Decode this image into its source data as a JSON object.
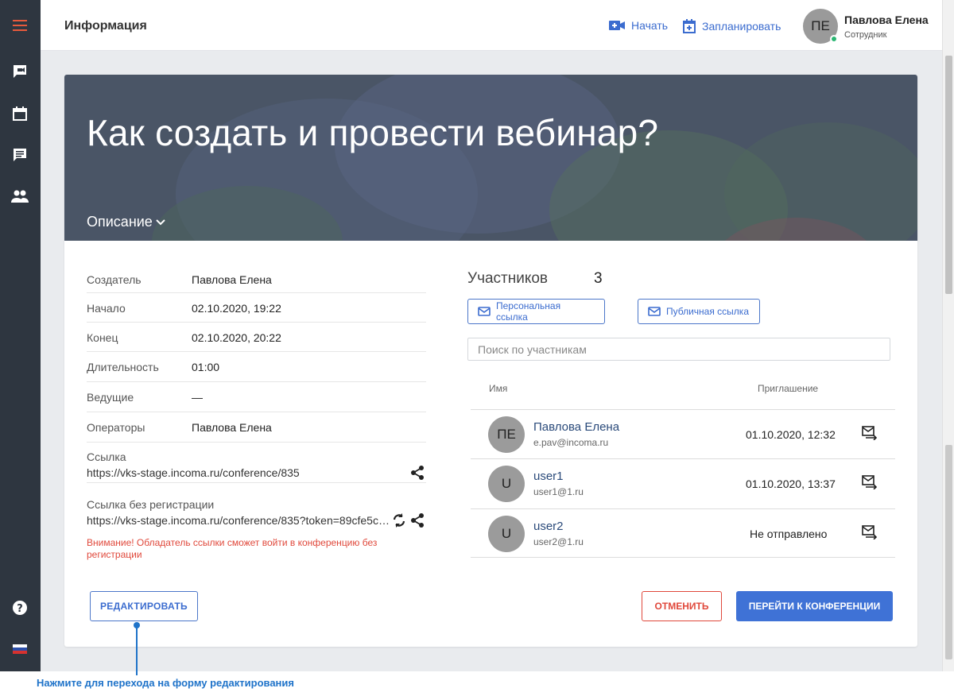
{
  "header": {
    "page_title": "Информация",
    "start_label": "Начать",
    "schedule_label": "Запланировать",
    "user": {
      "initials": "ПЕ",
      "name": "Павлова Елена",
      "role": "Сотрудник"
    }
  },
  "banner": {
    "title": "Как создать и провести вебинар?",
    "description_label": "Описание"
  },
  "details": {
    "rows": [
      {
        "label": "Создатель",
        "value": "Павлова Елена"
      },
      {
        "label": "Начало",
        "value": "02.10.2020, 19:22"
      },
      {
        "label": "Конец",
        "value": "02.10.2020, 20:22"
      },
      {
        "label": "Длительность",
        "value": "01:00"
      },
      {
        "label": "Ведущие",
        "value": "—"
      },
      {
        "label": "Операторы",
        "value": "Павлова Елена"
      }
    ],
    "link_label": "Ссылка",
    "link_value": "https://vks-stage.incoma.ru/conference/835",
    "noreg_label": "Ссылка без регистрации",
    "noreg_value": "https://vks-stage.incoma.ru/conference/835?token=89cfe5ca...",
    "warning": "Внимание! Обладатель ссылки сможет войти в конференцию без регистрации"
  },
  "participants": {
    "title": "Участников",
    "count": "3",
    "personal_link_label": "Персональная ссылка",
    "public_link_label": "Публичная ссылка",
    "search_placeholder": "Поиск по участникам",
    "col_name": "Имя",
    "col_invite": "Приглашение",
    "rows": [
      {
        "initials": "ПЕ",
        "name": "Павлова Елена",
        "email": "e.pav@incoma.ru",
        "invite": "01.10.2020, 12:32"
      },
      {
        "initials": "U",
        "name": "user1",
        "email": "user1@1.ru",
        "invite": "01.10.2020, 13:37"
      },
      {
        "initials": "U",
        "name": "user2",
        "email": "user2@1.ru",
        "invite": "Не отправлено"
      }
    ]
  },
  "actions": {
    "edit_label": "РЕДАКТИРОВАТЬ",
    "cancel_label": "ОТМЕНИТЬ",
    "go_label": "ПЕРЕЙТИ К КОНФЕРЕНЦИИ"
  },
  "callout": {
    "text": "Нажмите для перехода на форму редактирования"
  },
  "colors": {
    "accent": "#3f72d6",
    "danger": "#e0483b",
    "sidebar": "#2e3640",
    "online": "#2bb673"
  },
  "icons": [
    "menu-icon",
    "chat-icon",
    "calendar-icon",
    "message-icon",
    "people-icon",
    "help-icon",
    "flag-icon",
    "video-icon",
    "calendar-plus-icon",
    "share-icon",
    "refresh-icon",
    "mail-icon",
    "resend-icon",
    "chevron-down-icon"
  ]
}
